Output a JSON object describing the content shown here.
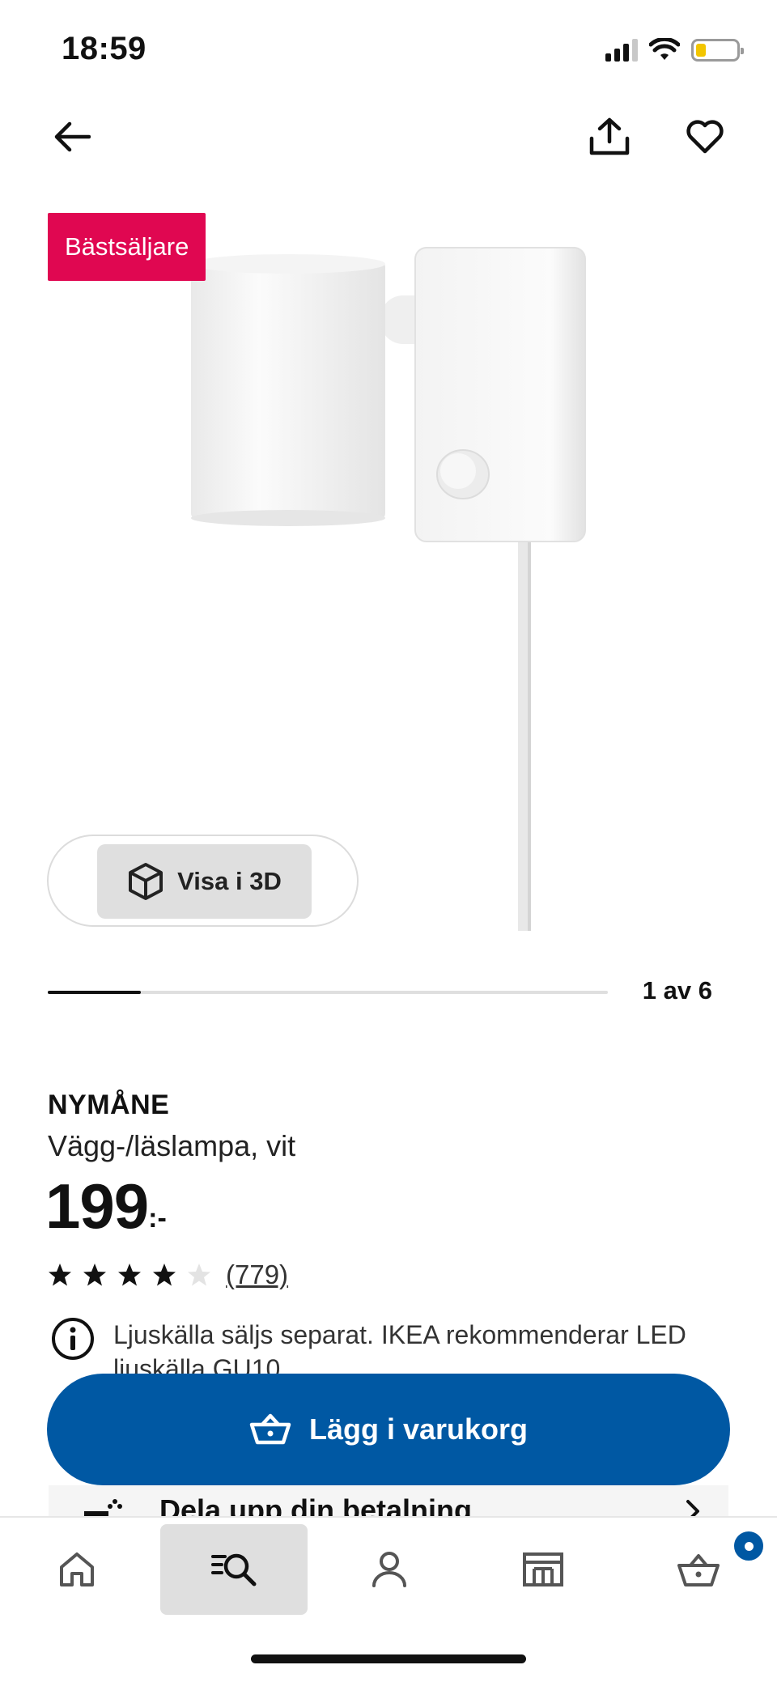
{
  "status_bar": {
    "time": "18:59",
    "battery_fraction": 0.25,
    "icons": [
      "cellular-signal-icon",
      "wifi-icon",
      "battery-icon"
    ]
  },
  "top_nav": {
    "icons": [
      "back-arrow-icon",
      "share-icon",
      "heart-icon"
    ]
  },
  "product": {
    "badge": "Bästsäljare",
    "view_3d_label": "Visa i 3D",
    "gallery": {
      "current": 1,
      "total": 6,
      "label": "1 av 6"
    },
    "name": "NYMÅNE",
    "description": "Vägg-/läslampa, vit",
    "price": "199",
    "price_suffix": ":-",
    "rating": {
      "stars": 4,
      "max": 5,
      "count_label": "(779)"
    },
    "info_text": "Ljuskälla säljs separat. IKEA rekommenderar LED ljuskälla GU10"
  },
  "actions": {
    "add_to_cart": "Lägg i varukorg",
    "installment": "Dela upp din betalning"
  },
  "tab_bar": {
    "tabs": [
      "home-icon",
      "search-icon",
      "profile-icon",
      "store-icon",
      "cart-icon"
    ],
    "active": "search-icon"
  },
  "colors": {
    "badge": "#e00751",
    "primary": "#0058a3",
    "battery": "#f2c500"
  }
}
